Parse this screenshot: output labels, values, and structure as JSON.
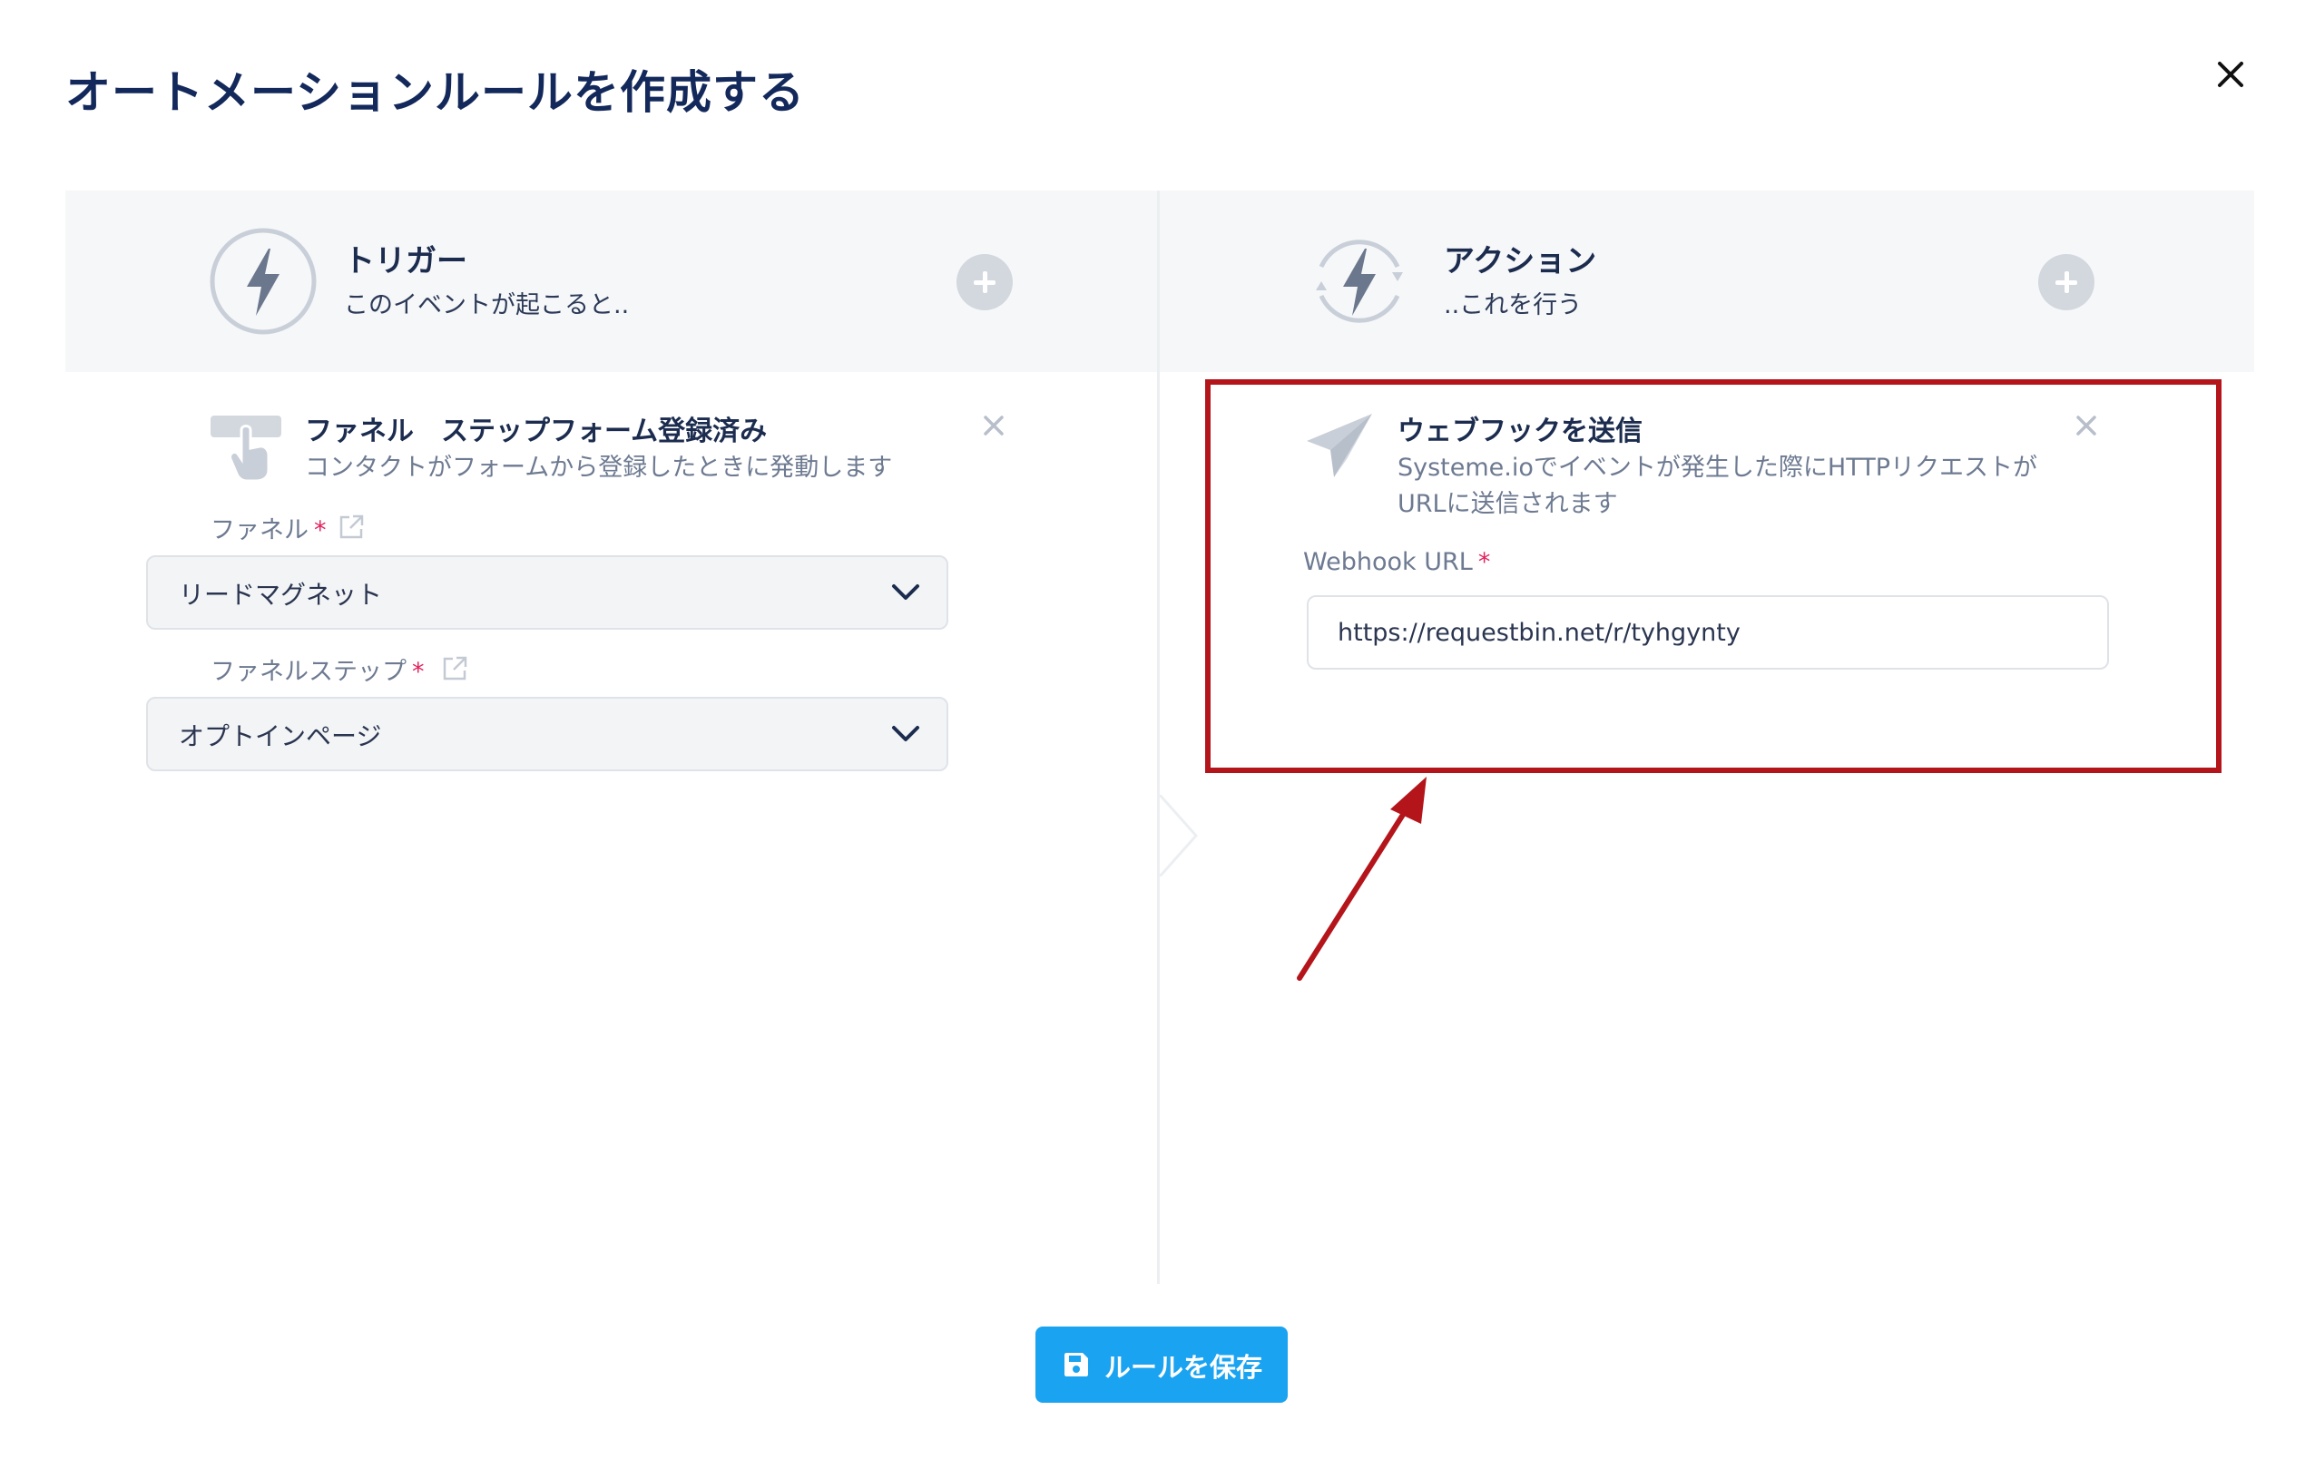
{
  "modal": {
    "title": "オートメーションルールを作成する"
  },
  "trigger": {
    "title": "トリガー",
    "subtitle": "このイベントが起こると..",
    "step": {
      "title": "ファネル　ステップフォーム登録済み",
      "description": "コンタクトがフォームから登録したときに発動します"
    },
    "fields": [
      {
        "label": "ファネル",
        "required_mark": "*",
        "value": "リードマグネット"
      },
      {
        "label": "ファネルステップ",
        "required_mark": "*",
        "value": "オプトインページ"
      }
    ]
  },
  "action": {
    "title": "アクション",
    "subtitle": "..これを行う",
    "step": {
      "title": "ウェブフックを送信",
      "description_line1": "Systeme.ioでイベントが発生した際にHTTPリクエストが",
      "description_line2": "URLに送信されます"
    },
    "webhook": {
      "label": "Webhook URL",
      "required_mark": "*",
      "value": "https://requestbin.net/r/tyhgynty"
    }
  },
  "footer": {
    "save_label": "ルールを保存"
  },
  "icons": {
    "close": "close-icon",
    "bolt": "lightning-bolt-icon",
    "plus": "plus-circle-icon",
    "hand": "hand-pointer-form-icon",
    "paper_plane": "paper-plane-icon",
    "external": "external-link-icon",
    "chevron": "chevron-down-icon",
    "save": "floppy-disk-icon"
  },
  "colors": {
    "title": "#14295b",
    "header_bg": "#f6f7f9",
    "highlight": "#b4151b",
    "primary_button": "#1aa3f0",
    "required": "#e0245e"
  }
}
